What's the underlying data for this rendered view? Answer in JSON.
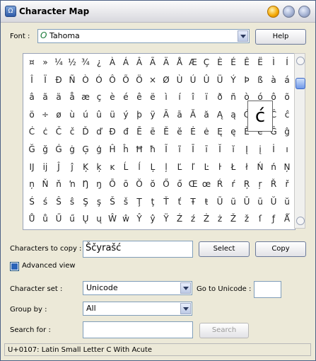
{
  "window": {
    "title": "Character Map",
    "icon": "charmap-icon"
  },
  "font_row": {
    "label": "Font :",
    "font_value": "Tahoma",
    "font_icon": "opentype-icon",
    "help_button": "Help"
  },
  "grid": {
    "rows": [
      [
        "¤",
        "»",
        "¼",
        "½",
        "¾",
        "¿",
        "À",
        "Á",
        "Â",
        "Ã",
        "Ä",
        "Å",
        "Æ",
        "Ç",
        "È",
        "É",
        "Ê",
        "Ë",
        "Ì",
        "Í"
      ],
      [
        "Î",
        "Ï",
        "Ð",
        "Ñ",
        "Ò",
        "Ó",
        "Ô",
        "Õ",
        "Ö",
        "×",
        "Ø",
        "Ù",
        "Ú",
        "Û",
        "Ü",
        "Ý",
        "Þ",
        "ß",
        "à",
        "á"
      ],
      [
        "â",
        "ã",
        "ä",
        "å",
        "æ",
        "ç",
        "è",
        "é",
        "ê",
        "ë",
        "ì",
        "í",
        "î",
        "ï",
        "ð",
        "ñ",
        "ò",
        "ó",
        "ô",
        "õ"
      ],
      [
        "ö",
        "÷",
        "ø",
        "ù",
        "ú",
        "û",
        "ü",
        "ý",
        "þ",
        "ÿ",
        "Ā",
        "ā",
        "Ă",
        "ă",
        "Ą",
        "ą",
        "Ć",
        "ć",
        "Ĉ",
        "ĉ"
      ],
      [
        "Ċ",
        "ċ",
        "Č",
        "č",
        "Ď",
        "ď",
        "Đ",
        "đ",
        "Ē",
        "ē",
        "Ĕ",
        "ĕ",
        "Ė",
        "ė",
        "Ę",
        "ę",
        "Ě",
        "ě",
        "Ĝ",
        "ĝ"
      ],
      [
        "Ğ",
        "ğ",
        "Ġ",
        "ġ",
        "Ģ",
        "ģ",
        "Ĥ",
        "ĥ",
        "Ħ",
        "ħ",
        "Ĩ",
        "ĩ",
        "Ī",
        "ī",
        "Ĭ",
        "ĭ",
        "Į",
        "į",
        "İ",
        "ı"
      ],
      [
        "Ĳ",
        "ĳ",
        "Ĵ",
        "ĵ",
        "Ķ",
        "ķ",
        "ĸ",
        "Ĺ",
        "ĺ",
        "Ļ",
        "ļ",
        "Ľ",
        "ľ",
        "Ŀ",
        "ŀ",
        "Ł",
        "ł",
        "Ń",
        "ń",
        "Ņ"
      ],
      [
        "ņ",
        "Ň",
        "ň",
        "ŉ",
        "Ŋ",
        "ŋ",
        "Ō",
        "ō",
        "Ŏ",
        "ŏ",
        "Ő",
        "ő",
        "Œ",
        "œ",
        "Ŕ",
        "ŕ",
        "Ŗ",
        "ŗ",
        "Ř",
        "ř"
      ],
      [
        "Ś",
        "ś",
        "Ŝ",
        "ŝ",
        "Ş",
        "ş",
        "Š",
        "š",
        "Ţ",
        "ţ",
        "Ť",
        "ť",
        "Ŧ",
        "ŧ",
        "Ũ",
        "ũ",
        "Ū",
        "ū",
        "Ŭ",
        "ŭ"
      ],
      [
        "Ů",
        "ů",
        "Ű",
        "ű",
        "Ų",
        "ų",
        "Ŵ",
        "ŵ",
        "Ŷ",
        "ŷ",
        "Ÿ",
        "Ź",
        "ź",
        "Ż",
        "ż",
        "Ž",
        "ž",
        "ſ",
        "ƒ",
        "Ǻ"
      ]
    ],
    "zoomed_char": "ć"
  },
  "copy_row": {
    "label": "Characters to copy :",
    "value": "Ščyrašć",
    "select_button": "Select",
    "copy_button": "Copy"
  },
  "advanced": {
    "label": "Advanced view",
    "checked": true
  },
  "charset_row": {
    "label": "Character set :",
    "value": "Unicode",
    "goto_label": "Go to Unicode :",
    "goto_value": ""
  },
  "groupby_row": {
    "label": "Group by :",
    "value": "All"
  },
  "search_row": {
    "label": "Search for :",
    "value": "",
    "button": "Search"
  },
  "status": {
    "text": "U+0107: Latin Small Letter C With Acute"
  }
}
